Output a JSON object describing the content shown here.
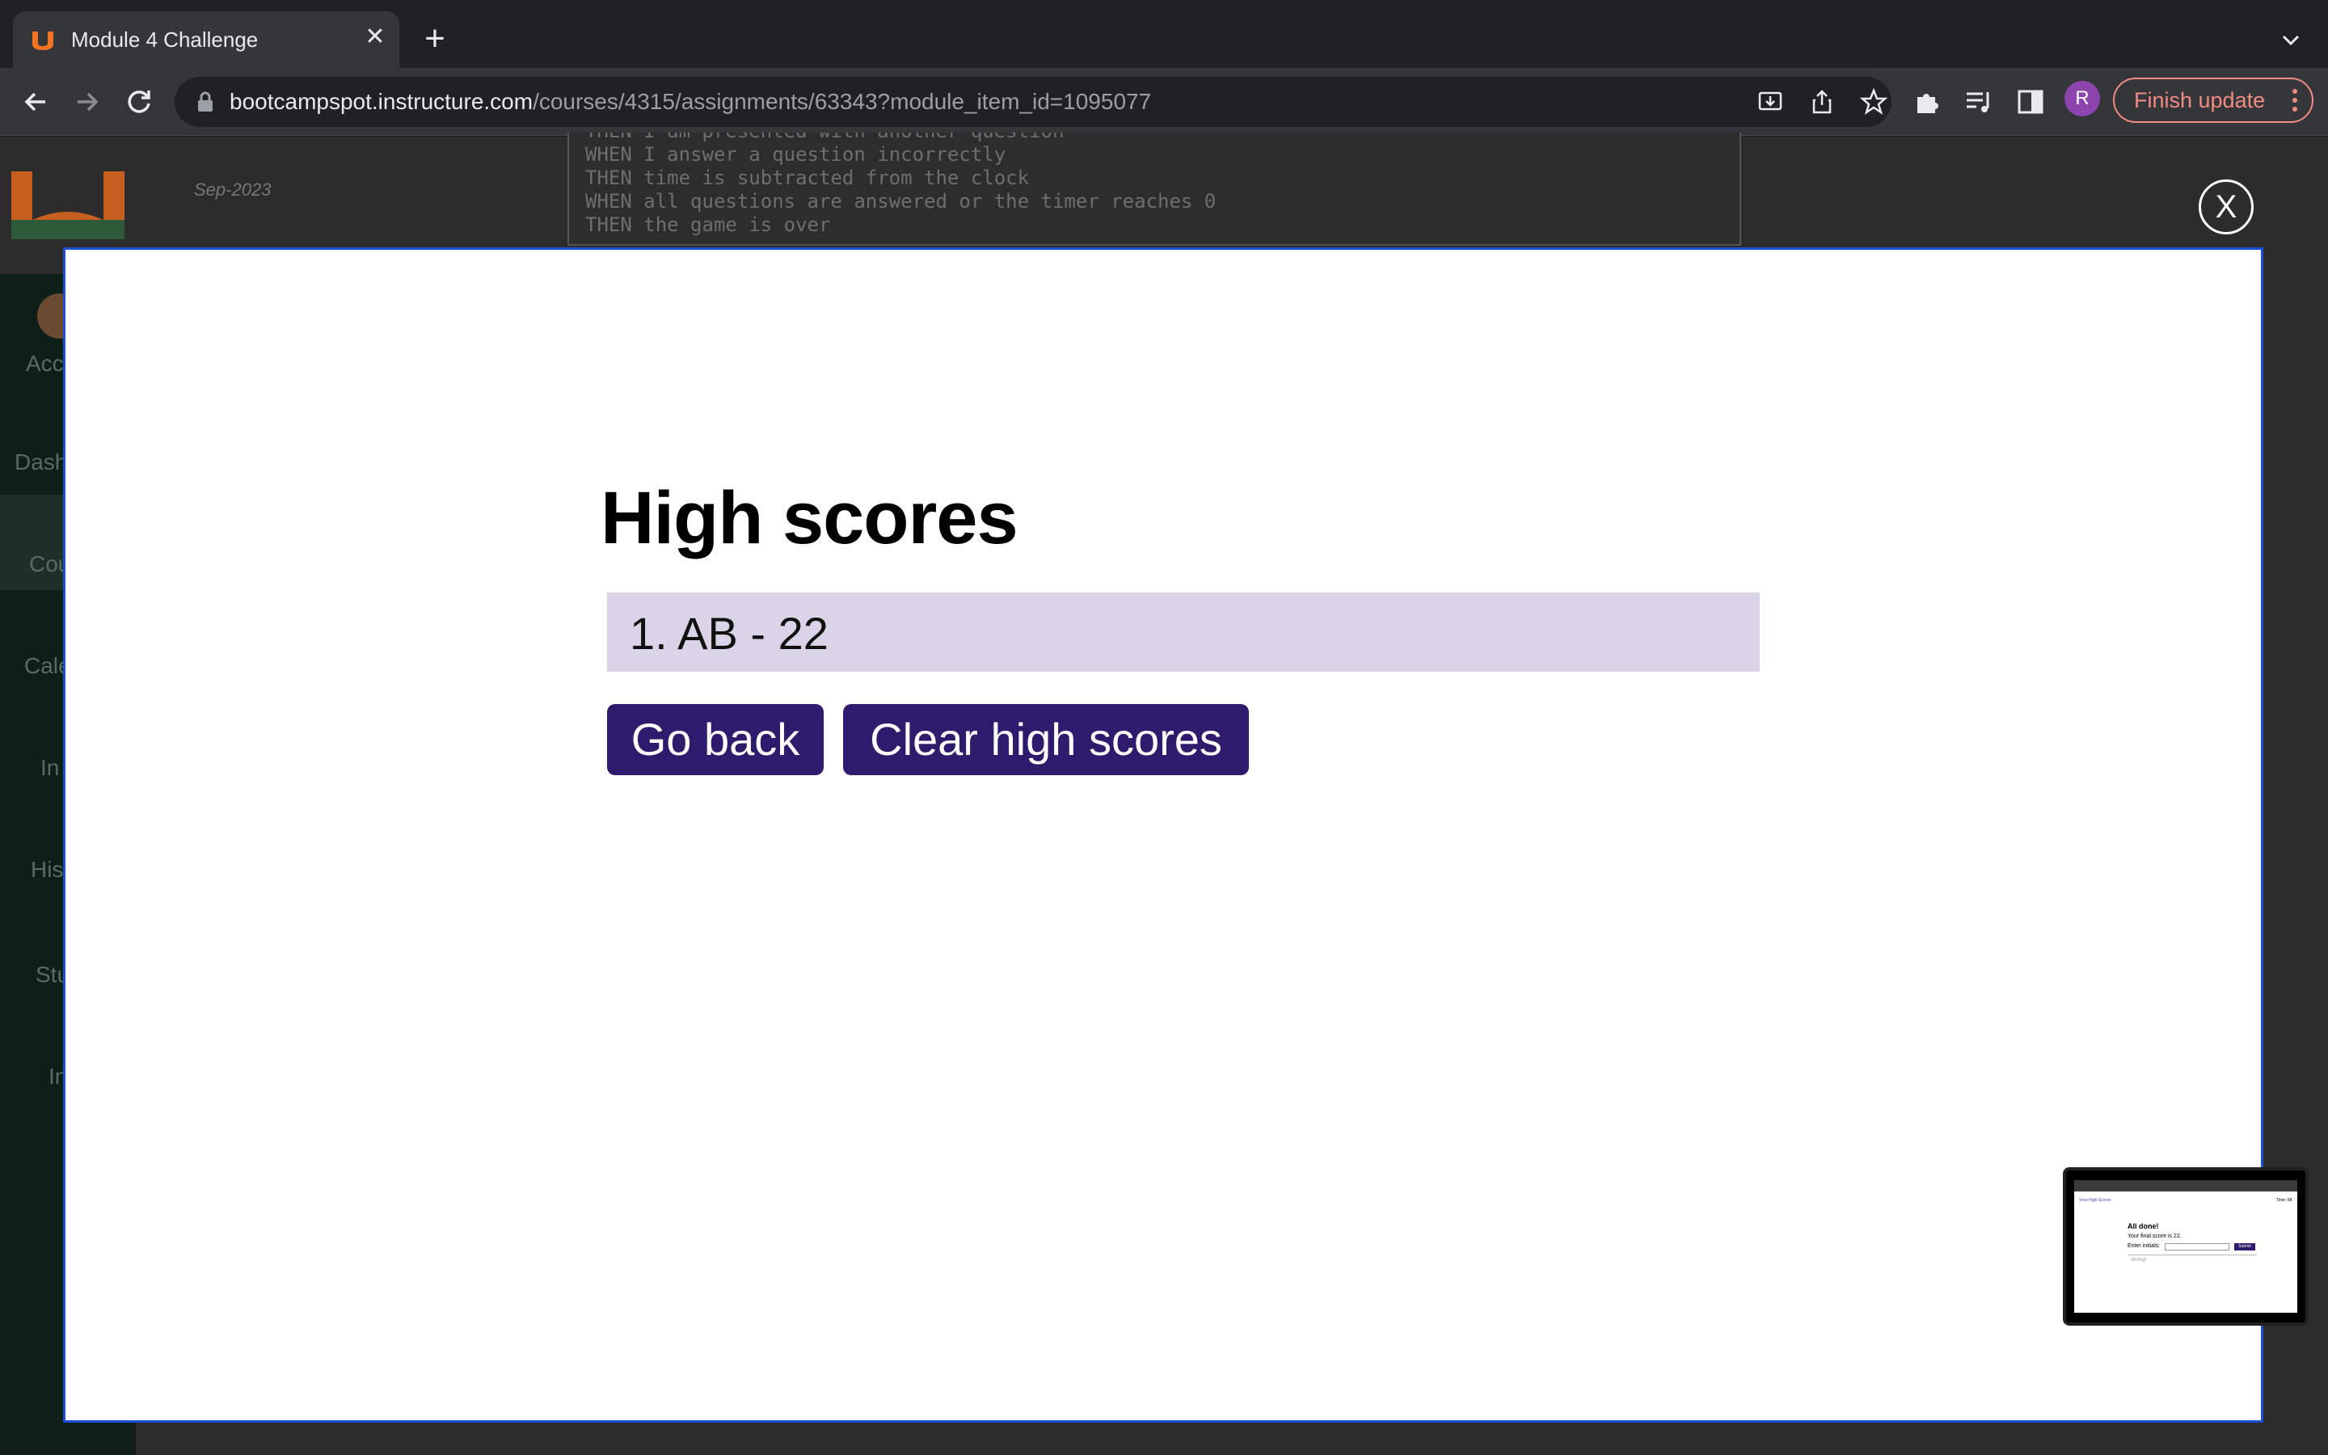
{
  "browser": {
    "tab_title": "Module 4 Challenge",
    "url_host": "bootcampspot.instructure.com",
    "url_path": "/courses/4315/assignments/63343?module_item_id=1095077",
    "profile_initial": "R",
    "finish_update_label": "Finish update"
  },
  "background": {
    "date": "Sep-2023",
    "nav_labels": [
      "Acc",
      "Dash",
      "Cou",
      "Cale",
      "In",
      "His",
      "Stu",
      "In"
    ],
    "code_lines": [
      "THEN I am presented with another question",
      "WHEN I answer a question incorrectly",
      "THEN time is subtracted from the clock",
      "WHEN all questions are answered or the timer reaches 0",
      "THEN the game is over"
    ],
    "close_label": "X"
  },
  "modal": {
    "title": "High scores",
    "scores": [
      "1. AB - 22"
    ],
    "go_back_label": "Go back",
    "clear_label": "Clear high scores"
  },
  "pip": {
    "view_link": "View High Scores",
    "time": "Time: 68",
    "heading": "All done!",
    "final_score": "Your final score is 22.",
    "enter_initials": "Enter initials:",
    "submit": "Submit",
    "feedback": "Wrong!"
  },
  "colors": {
    "accent": "#2e1b6b",
    "score_bg": "#d9d4e7",
    "modal_border": "#1a4fd6",
    "update_badge": "#f28b82"
  }
}
